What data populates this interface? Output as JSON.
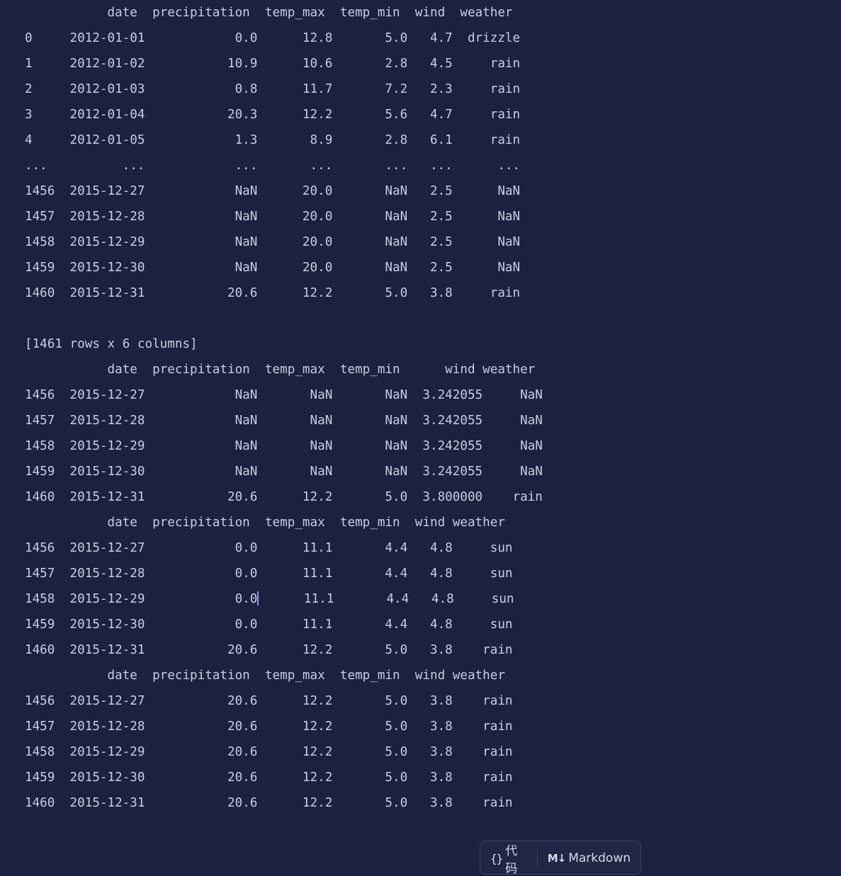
{
  "output_blocks": [
    {
      "lines": [
        "           date  precipitation  temp_max  temp_min  wind  weather",
        "0     2012-01-01            0.0      12.8       5.0   4.7  drizzle",
        "1     2012-01-02           10.9      10.6       2.8   4.5     rain",
        "2     2012-01-03            0.8      11.7       7.2   2.3     rain",
        "3     2012-01-04           20.3      12.2       5.6   4.7     rain",
        "4     2012-01-05            1.3       8.9       2.8   6.1     rain",
        "...          ...            ...       ...       ...   ...      ...",
        "1456  2015-12-27            NaN      20.0       NaN   2.5      NaN",
        "1457  2015-12-28            NaN      20.0       NaN   2.5      NaN",
        "1458  2015-12-29            NaN      20.0       NaN   2.5      NaN",
        "1459  2015-12-30            NaN      20.0       NaN   2.5      NaN",
        "1460  2015-12-31           20.6      12.2       5.0   3.8     rain",
        "",
        "[1461 rows x 6 columns]"
      ]
    },
    {
      "lines": [
        "           date  precipitation  temp_max  temp_min      wind weather",
        "1456  2015-12-27            NaN       NaN       NaN  3.242055     NaN",
        "1457  2015-12-28            NaN       NaN       NaN  3.242055     NaN",
        "1458  2015-12-29            NaN       NaN       NaN  3.242055     NaN",
        "1459  2015-12-30            NaN       NaN       NaN  3.242055     NaN",
        "1460  2015-12-31           20.6      12.2       5.0  3.800000    rain"
      ]
    },
    {
      "lines": [
        "           date  precipitation  temp_max  temp_min  wind weather",
        "1456  2015-12-27            0.0      11.1       4.4   4.8     sun",
        "1457  2015-12-28            0.0      11.1       4.4   4.8     sun",
        "1458  2015-12-29            0.0      11.1       4.4   4.8     sun",
        "1459  2015-12-30            0.0      11.1       4.4   4.8     sun",
        "1460  2015-12-31           20.6      12.2       5.0   3.8    rain"
      ]
    },
    {
      "lines": [
        "           date  precipitation  temp_max  temp_min  wind weather",
        "1456  2015-12-27           20.6      12.2       5.0   3.8    rain",
        "1457  2015-12-28           20.6      12.2       5.0   3.8    rain",
        "1458  2015-12-29           20.6      12.2       5.0   3.8    rain",
        "1459  2015-12-30           20.6      12.2       5.0   3.8    rain",
        "1460  2015-12-31           20.6      12.2       5.0   3.8    rain"
      ]
    }
  ],
  "cell_toolbar": {
    "code_icon": "{}",
    "code_label": "代码",
    "markdown_icon": "M↓",
    "markdown_label": "Markdown"
  },
  "colors": {
    "background": "#1b2240",
    "text": "#c6cde4",
    "cursor": "#9b8cff"
  }
}
